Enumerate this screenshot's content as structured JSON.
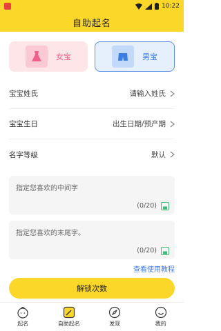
{
  "status_bar": {
    "time": "10:22"
  },
  "header": {
    "title": "自助起名"
  },
  "gender": {
    "girl_label": "女宝",
    "boy_label": "男宝"
  },
  "form": {
    "surname_label": "宝宝姓氏",
    "surname_value": "请输入姓氏",
    "birthday_label": "宝宝生日",
    "birthday_value": "出生日期/预产期",
    "grade_label": "名字等级",
    "grade_value": "默认"
  },
  "inputs": {
    "middle_placeholder": "指定您喜欢的中间字",
    "middle_counter": "(0/20)",
    "last_placeholder": "指定您喜欢的末尾字。",
    "last_counter": "(0/20)"
  },
  "tutorial_link": "查看使用教程",
  "unlock_button": "解锁次数",
  "tabs": [
    {
      "label": "起名",
      "icon": "baby-face-icon"
    },
    {
      "label": "自助起名",
      "icon": "edit-icon"
    },
    {
      "label": "发现",
      "icon": "compass-icon"
    },
    {
      "label": "我的",
      "icon": "smile-icon"
    }
  ],
  "colors": {
    "accent": "#fbd72a",
    "girl": "#f0608a",
    "boy": "#3e7de0",
    "link": "#3d7be0"
  }
}
